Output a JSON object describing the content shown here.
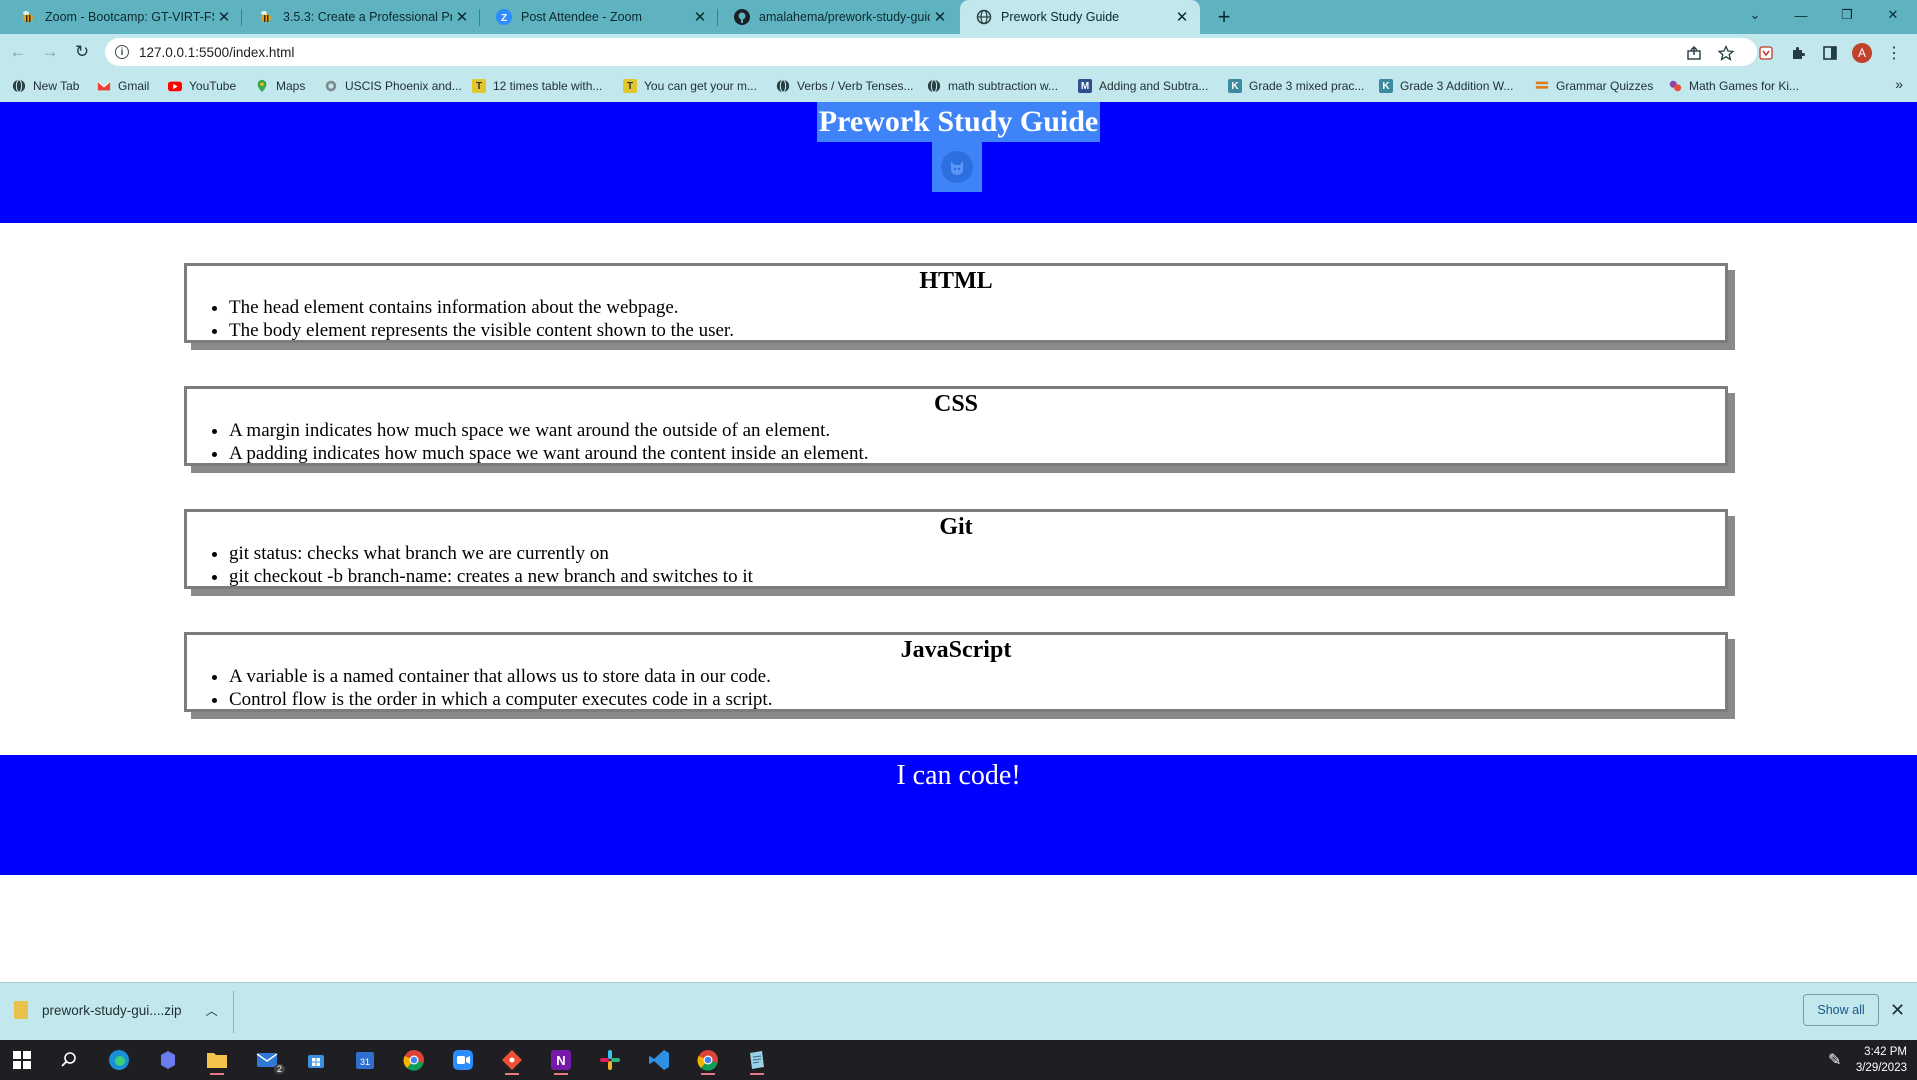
{
  "browser": {
    "tabs": [
      {
        "title": "Zoom - Bootcamp: GT-VIRT-FSF-",
        "icon": "bee-icon",
        "active": false
      },
      {
        "title": "3.5.3: Create a Professional Proje",
        "icon": "bee-icon",
        "active": false
      },
      {
        "title": "Post Attendee - Zoom",
        "icon": "zoom-icon",
        "active": false
      },
      {
        "title": "amalahema/prework-study-guide",
        "icon": "github-icon",
        "active": false
      },
      {
        "title": "Prework Study Guide",
        "icon": "globe-icon",
        "active": true
      }
    ],
    "new_tab_label": "+",
    "address": "127.0.0.1:5500/index.html",
    "profile_initial": "A",
    "bookmarks": [
      {
        "label": "New Tab",
        "icon": "globe-icon"
      },
      {
        "label": "Gmail",
        "icon": "gmail-icon"
      },
      {
        "label": "YouTube",
        "icon": "youtube-icon"
      },
      {
        "label": "Maps",
        "icon": "maps-icon"
      },
      {
        "label": "USCIS Phoenix and...",
        "icon": "uscis-icon"
      },
      {
        "label": "12 times table with...",
        "icon": "bookmark-icon"
      },
      {
        "label": "You can get your m...",
        "icon": "bookmark-icon"
      },
      {
        "label": "Verbs / Verb Tenses...",
        "icon": "globe-icon"
      },
      {
        "label": "math subtraction w...",
        "icon": "globe-icon"
      },
      {
        "label": "Adding and Subtra...",
        "icon": "m-icon"
      },
      {
        "label": "Grade 3 mixed prac...",
        "icon": "worksheet-icon"
      },
      {
        "label": "Grade 3 Addition W...",
        "icon": "worksheet-icon"
      },
      {
        "label": "Grammar Quizzes",
        "icon": "grammar-icon"
      },
      {
        "label": "Math Games for Ki...",
        "icon": "mathgames-icon"
      }
    ],
    "bookmarks_more": "»"
  },
  "page": {
    "title": "Prework Study Guide",
    "sections": [
      {
        "heading": "HTML",
        "notes": [
          "The head element contains information about the webpage.",
          "The body element represents the visible content shown to the user."
        ]
      },
      {
        "heading": "CSS",
        "notes": [
          "A margin indicates how much space we want around the outside of an element.",
          "A padding indicates how much space we want around the content inside an element."
        ]
      },
      {
        "heading": "Git",
        "notes": [
          "git status: checks what branch we are currently on",
          "git checkout -b branch-name: creates a new branch and switches to it"
        ]
      },
      {
        "heading": "JavaScript",
        "notes": [
          "A variable is a named container that allows us to store data in our code.",
          "Control flow is the order in which a computer executes code in a script."
        ]
      }
    ],
    "footer_text": "I can code!"
  },
  "downloads": {
    "file_name": "prework-study-gui....zip",
    "show_all_label": "Show all"
  },
  "taskbar": {
    "time": "3:42 PM",
    "date": "3/29/2023",
    "mail_badge": "2"
  },
  "colors": {
    "page_header_bg": "#0000ff",
    "title_highlight": "#3e84f8",
    "chrome_frame": "#5fb2bf",
    "chrome_toolbar": "#c2e7ec"
  }
}
